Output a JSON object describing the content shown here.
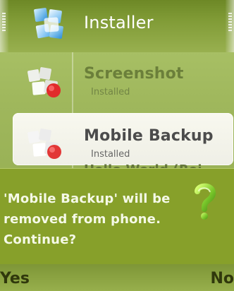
{
  "window": {
    "title": "Installer"
  },
  "list": {
    "items": [
      {
        "name": "Screenshot",
        "status": "Installed"
      },
      {
        "name": "Mobile Backup",
        "status": "Installed"
      },
      {
        "name": "Hello World (Rei"
      }
    ]
  },
  "dialog": {
    "message": "'Mobile Backup' will be removed from phone. Continue?",
    "icon": "question-mark-icon"
  },
  "softkeys": {
    "left": "Yes",
    "right": "No"
  },
  "colors": {
    "theme_green": "#87a02a",
    "selected_background": "#f4f4ea",
    "title_text": "#ffffff",
    "dialog_text": "#f5f9e7"
  }
}
